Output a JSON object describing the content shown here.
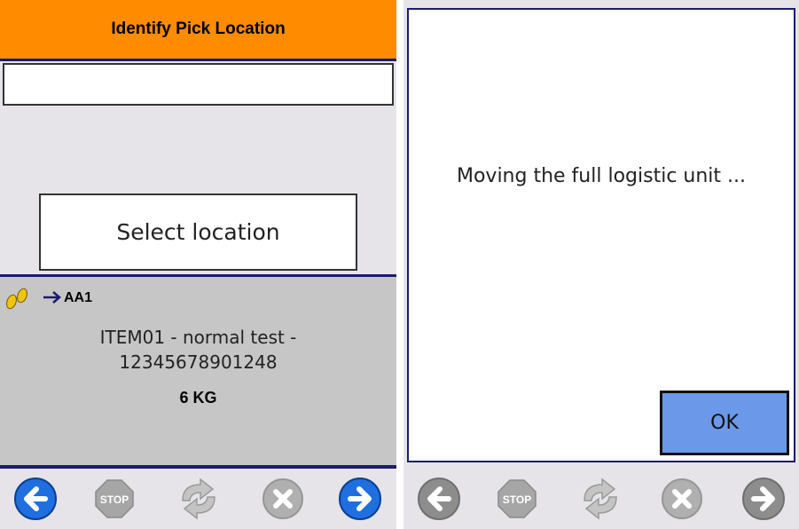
{
  "left_screen": {
    "title": "Identify Pick Location",
    "scan_input": {
      "value": "",
      "placeholder": ""
    },
    "select_location_label": "Select location",
    "location_code": "AA1",
    "item_line1": "ITEM01 - normal test -",
    "item_line2": "12345678901248",
    "weight": "6 KG",
    "toolbar": [
      "back-icon",
      "stop-icon",
      "refresh-icon",
      "cancel-icon",
      "forward-icon"
    ],
    "toolbar_enabled": {
      "back": true,
      "stop": false,
      "refresh": false,
      "cancel": false,
      "forward": true
    }
  },
  "right_screen": {
    "dialog_message": "Moving the full logistic unit ...",
    "ok_label": "OK",
    "toolbar": [
      "back-icon",
      "stop-icon",
      "refresh-icon",
      "cancel-icon",
      "forward-icon"
    ],
    "toolbar_enabled": {
      "back": false,
      "stop": false,
      "refresh": false,
      "cancel": false,
      "forward": false
    }
  },
  "stop_icon_text": "STOP",
  "colors": {
    "title_bar": "#ff8c00",
    "navy": "#1b1b6b",
    "panel_bg": "#e6e4e9",
    "info_bg": "#c6c6c6",
    "ok_button": "#6b98e8",
    "nav_active": "#1f6fe0",
    "nav_disabled": "#8d8d8d",
    "footprint": "#f1c40f"
  }
}
